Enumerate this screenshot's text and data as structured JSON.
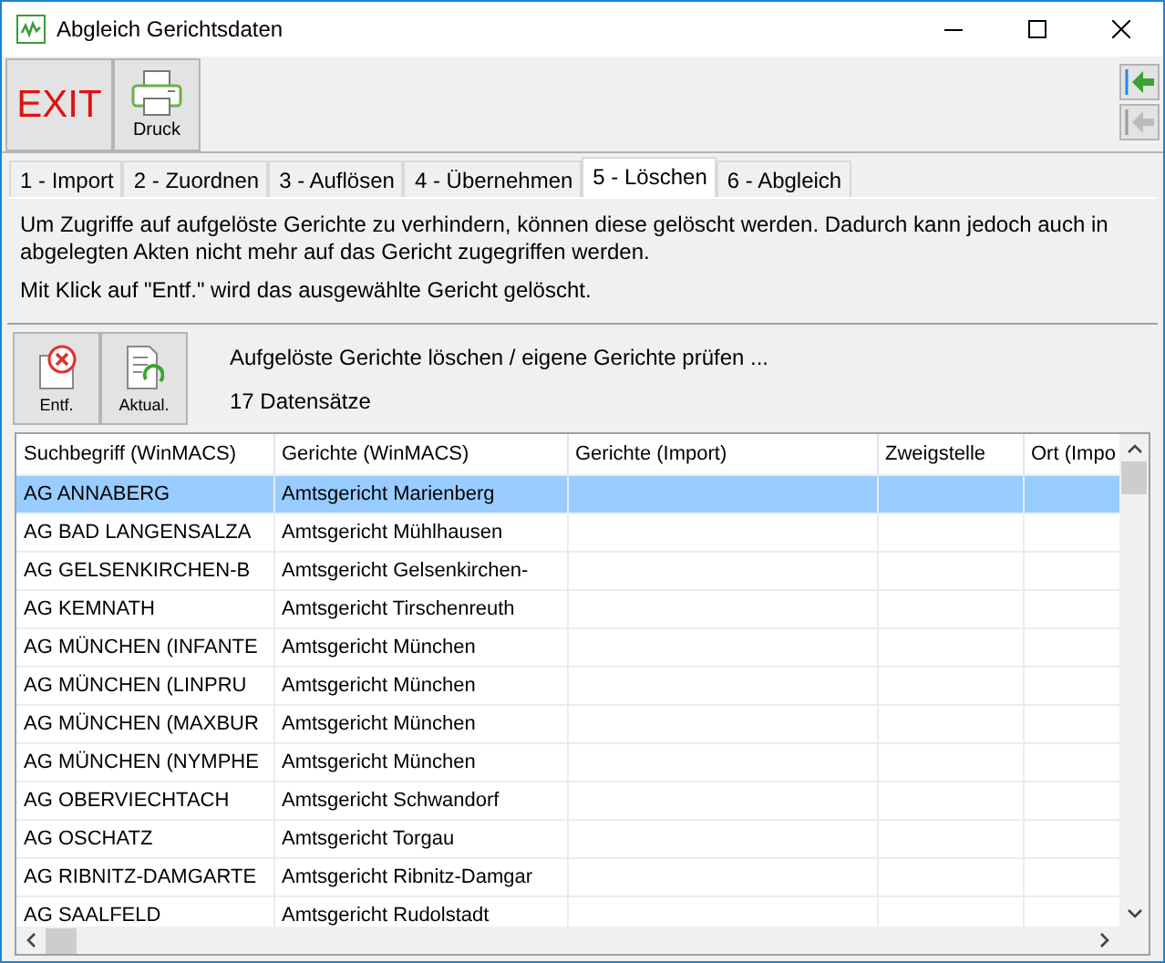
{
  "window": {
    "title": "Abgleich Gerichtsdaten"
  },
  "toolbar": {
    "buttons": [
      {
        "kind": "exit",
        "label": "EXIT"
      },
      {
        "kind": "print",
        "label": "Druck"
      }
    ]
  },
  "tabs": [
    {
      "label": "1 - Import",
      "selected": false
    },
    {
      "label": "2 - Zuordnen",
      "selected": false
    },
    {
      "label": "3 - Auflösen",
      "selected": false
    },
    {
      "label": "4 - Übernehmen",
      "selected": false
    },
    {
      "label": "5 - Löschen",
      "selected": true
    },
    {
      "label": "6 - Abgleich",
      "selected": false
    }
  ],
  "info": [
    "Um Zugriffe auf aufgelöste Gerichte zu verhindern, können diese gelöscht werden. Dadurch kann jedoch auch in abgelegten Akten nicht mehr auf das Gericht zugegriffen werden.",
    "Mit Klick auf \"Entf.\" wird das ausgewählte Gericht gelöscht."
  ],
  "actions": {
    "buttons": [
      {
        "kind": "delete",
        "label": "Entf."
      },
      {
        "kind": "refresh",
        "label": "Aktual."
      }
    ],
    "title": "Aufgelöste Gerichte löschen / eigene Gerichte prüfen ...",
    "count": "17 Datensätze"
  },
  "table": {
    "columns": [
      "Suchbegriff (WinMACS)",
      "Gerichte (WinMACS)",
      "Gerichte (Import)",
      "Zweigstelle",
      "Ort (Impo"
    ],
    "rows": [
      {
        "search": "AG ANNABERG",
        "court": "Amtsgericht Marienberg",
        "selected": true
      },
      {
        "search": "AG BAD LANGENSALZA",
        "court": "Amtsgericht Mühlhausen",
        "selected": false
      },
      {
        "search": "AG GELSENKIRCHEN-B",
        "court": "Amtsgericht Gelsenkirchen-",
        "selected": false
      },
      {
        "search": "AG KEMNATH",
        "court": "Amtsgericht Tirschenreuth",
        "selected": false
      },
      {
        "search": "AG MÜNCHEN (INFANTE",
        "court": "Amtsgericht München",
        "selected": false
      },
      {
        "search": "AG MÜNCHEN (LINPRU",
        "court": "Amtsgericht München",
        "selected": false
      },
      {
        "search": "AG MÜNCHEN (MAXBUR",
        "court": "Amtsgericht München",
        "selected": false
      },
      {
        "search": "AG MÜNCHEN (NYMPHE",
        "court": "Amtsgericht München",
        "selected": false
      },
      {
        "search": "AG OBERVIECHTACH",
        "court": "Amtsgericht Schwandorf",
        "selected": false
      },
      {
        "search": "AG OSCHATZ",
        "court": "Amtsgericht Torgau",
        "selected": false
      },
      {
        "search": "AG RIBNITZ-DAMGARTE",
        "court": "Amtsgericht Ribnitz-Damgar",
        "selected": false
      },
      {
        "search": "AG SAALFELD",
        "court": "Amtsgericht Rudolstadt",
        "selected": false
      }
    ]
  }
}
